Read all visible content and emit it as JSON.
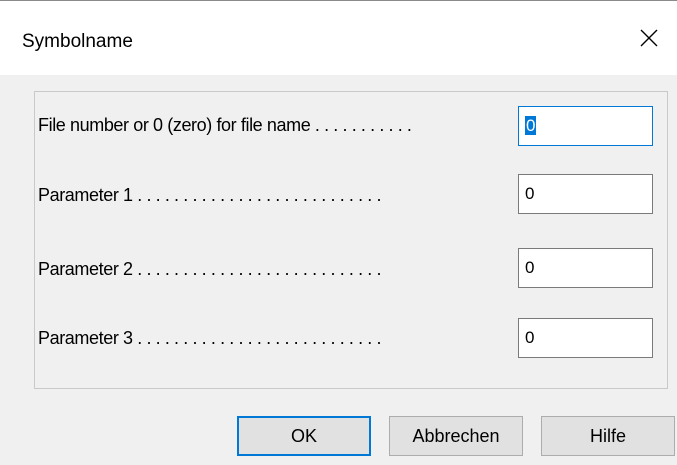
{
  "dialog": {
    "title": "Symbolname",
    "close_icon": "close-icon"
  },
  "fields": [
    {
      "label": "File number or 0 (zero) for file name . . . . . . . . . . .",
      "value": "0"
    },
    {
      "label": "Parameter 1 . . . . . . . . . . . . . . . . . . . . . . . . . . .",
      "value": "0"
    },
    {
      "label": "Parameter 2 . . . . . . . . . . . . . . . . . . . . . . . . . . .",
      "value": "0"
    },
    {
      "label": "Parameter 3 . . . . . . . . . . . . . . . . . . . . . . . . . . .",
      "value": "0"
    }
  ],
  "buttons": {
    "ok": "OK",
    "cancel": "Abbrechen",
    "help": "Hilfe"
  },
  "colors": {
    "accent": "#0078d7",
    "dialog_bg": "#f0f0f0"
  }
}
